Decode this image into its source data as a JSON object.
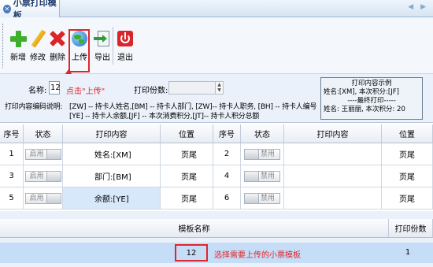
{
  "tab": {
    "title": "小票打印模板",
    "close_glyph": "✕",
    "nav": "◀ ▶"
  },
  "toolbar": {
    "add_label": "新增",
    "edit_label": "修改",
    "delete_label": "删除",
    "upload_label": "上传",
    "export_label": "导出",
    "exit_label": "退出"
  },
  "form": {
    "name_label": "名称:",
    "name_value": "12",
    "annotation": "点击\"上传\"",
    "copies_label": "打印份数:",
    "encoding_label": "打印内容编码说明:",
    "encoding_line1": "[ZW] -- 持卡人姓名,[BM] -- 持卡人部门, [ZW]-- 持卡人职务, [BH] -- 持卡人编号",
    "encoding_line2": "[YE] -- 持卡人余额,[JF] -- 本次消费积分,[JT]-- 持卡人积分总额"
  },
  "example": {
    "title": "打印内容示例",
    "line1": "姓名:[XM], 本次积分:[JF]",
    "line2": "----最终打印-----",
    "line3": "姓名: 王丽丽, 本次积分: 20"
  },
  "table": {
    "headers": [
      "序号",
      "状态",
      "打印内容",
      "位置",
      "序号",
      "状态",
      "打印内容",
      "位置"
    ],
    "rows": [
      {
        "left": {
          "no": "1",
          "status": "启用",
          "content": "姓名:[XM]",
          "position": "页尾"
        },
        "right": {
          "no": "2",
          "status": "禁用",
          "content": "",
          "position": "页尾"
        }
      },
      {
        "left": {
          "no": "3",
          "status": "启用",
          "content": "部门:[BM]",
          "position": "页尾"
        },
        "right": {
          "no": "4",
          "status": "禁用",
          "content": "",
          "position": "页尾"
        }
      },
      {
        "left": {
          "no": "5",
          "status": "启用",
          "content": "余额:[YE]",
          "position": "页尾"
        },
        "right": {
          "no": "6",
          "status": "禁用",
          "content": "",
          "position": "页尾"
        }
      }
    ]
  },
  "templates": {
    "headers": [
      "模板名称",
      "打印份数"
    ],
    "selected": {
      "name": "12",
      "copies": "1"
    },
    "note": "选择需要上传的小票模板"
  },
  "colors": {
    "annotation_red": "#e0262b",
    "selection_blue": "#c5ddf7",
    "panel_bg": "#eaf1fa"
  }
}
